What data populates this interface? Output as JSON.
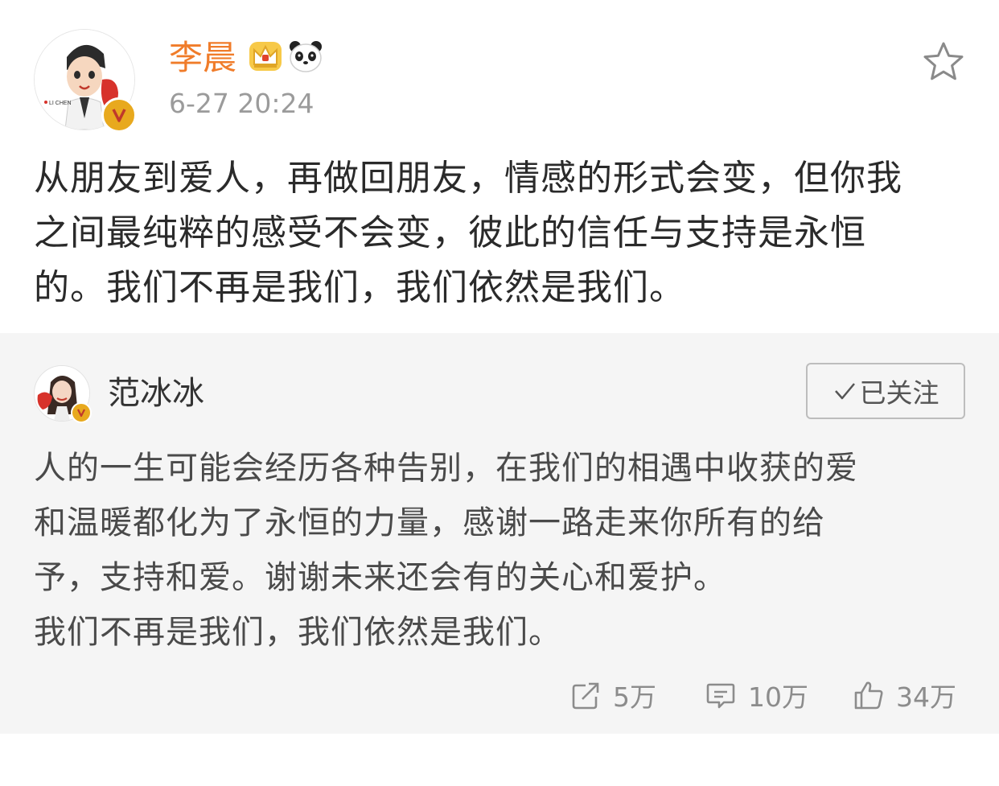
{
  "author": {
    "name": "李晨",
    "time": "6-27 20:24",
    "avatar_caption": "LI CHEN"
  },
  "post": {
    "lines": [
      "从朋友到爱人，再做回朋友，情感的形式会变，但你我",
      "之间最纯粹的感受不会变，彼此的信任与支持是永恒",
      "的。我们不再是我们，我们依然是我们。"
    ]
  },
  "repost": {
    "author": "范冰冰",
    "follow_label": "已关注",
    "lines": [
      "人的一生可能会经历各种告别，在我们的相遇中收获的爱",
      "和温暖都化为了永恒的力量，感谢一路走来你所有的给",
      "予，支持和爱。谢谢未来还会有的关心和爱护。",
      "我们不再是我们，我们依然是我们。"
    ],
    "stats": {
      "reposts": "5万",
      "comments": "10万",
      "likes": "34万"
    }
  },
  "icons": {
    "favorite": "star-outline-icon",
    "repost": "share-arrow-icon",
    "comment": "comment-bubble-icon",
    "like": "thumbs-up-icon",
    "verified": "verified-v-icon"
  },
  "colors": {
    "author_name": "#f07c2a",
    "verified_badge": "#e8a91e",
    "repost_bg": "#f5f5f5",
    "meta_gray": "#9b9b9b"
  }
}
